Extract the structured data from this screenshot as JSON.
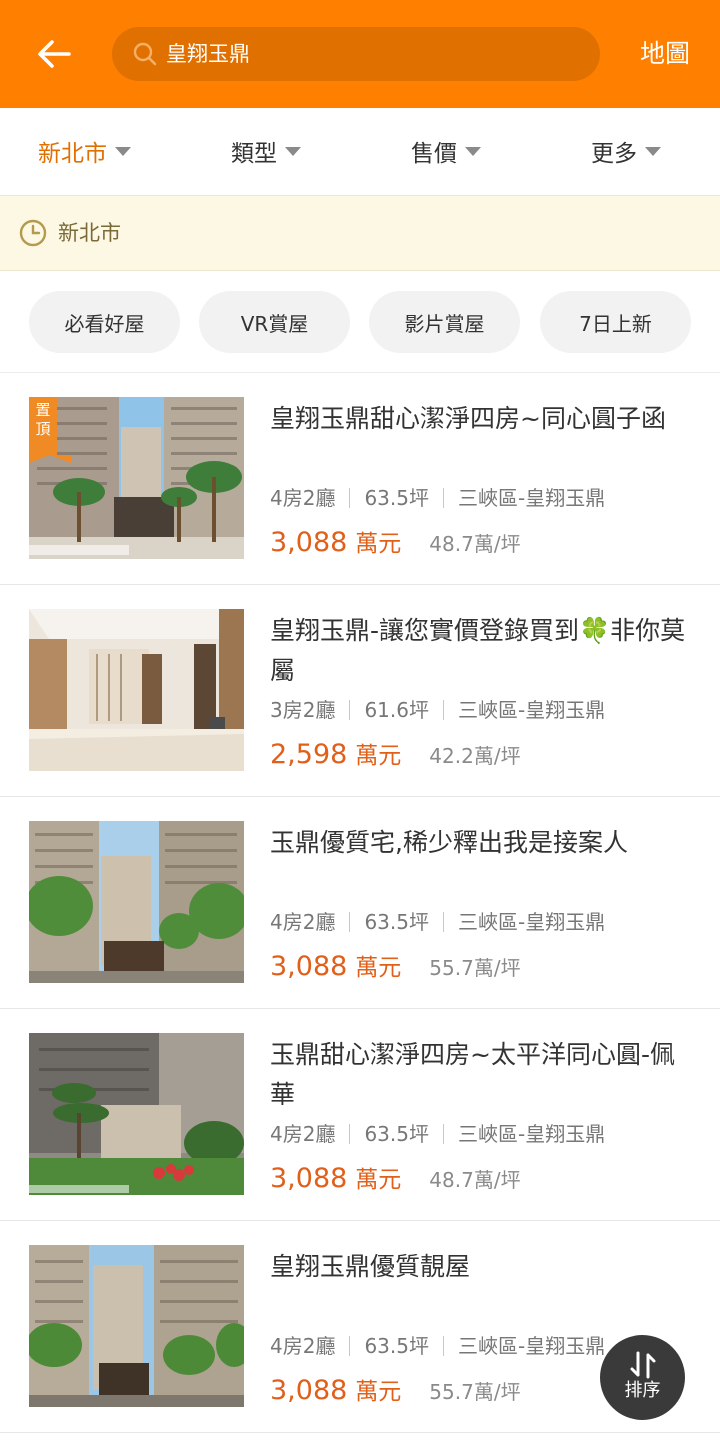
{
  "header": {
    "search_value": "皇翔玉鼎",
    "map_label": "地圖"
  },
  "filters": [
    {
      "label": "新北市",
      "active": true
    },
    {
      "label": "類型",
      "active": false
    },
    {
      "label": "售價",
      "active": false
    },
    {
      "label": "更多",
      "active": false
    }
  ],
  "recent_region": {
    "label": "新北市"
  },
  "chips": [
    "必看好屋",
    "VR賞屋",
    "影片賞屋",
    "7日上新"
  ],
  "listings": [
    {
      "title": "皇翔玉鼎甜心潔淨四房~同心圓子函",
      "badge": "置頂",
      "layout": "4房2廳",
      "area": "63.5坪",
      "location": "三峽區-皇翔玉鼎",
      "price": "3,088",
      "price_unit": "萬元",
      "unit_price": "48.7萬/坪"
    },
    {
      "title": "皇翔玉鼎-讓您實價登錄買到🍀非你莫屬",
      "badge": "",
      "layout": "3房2廳",
      "area": "61.6坪",
      "location": "三峽區-皇翔玉鼎",
      "price": "2,598",
      "price_unit": "萬元",
      "unit_price": "42.2萬/坪"
    },
    {
      "title": "玉鼎優質宅,稀少釋出我是接案人",
      "badge": "",
      "layout": "4房2廳",
      "area": "63.5坪",
      "location": "三峽區-皇翔玉鼎",
      "price": "3,088",
      "price_unit": "萬元",
      "unit_price": "55.7萬/坪"
    },
    {
      "title": "玉鼎甜心潔淨四房~太平洋同心圓-佩華",
      "badge": "",
      "layout": "4房2廳",
      "area": "63.5坪",
      "location": "三峽區-皇翔玉鼎",
      "price": "3,088",
      "price_unit": "萬元",
      "unit_price": "48.7萬/坪"
    },
    {
      "title": "皇翔玉鼎優質靚屋",
      "badge": "",
      "layout": "4房2廳",
      "area": "63.5坪",
      "location": "三峽區-皇翔玉鼎",
      "price": "3,088",
      "price_unit": "萬元",
      "unit_price": "55.7萬/坪"
    }
  ],
  "sort_button": {
    "label": "排序"
  },
  "colors": {
    "brand": "#ff8000",
    "price": "#e0601a",
    "badge": "#f08a24"
  }
}
